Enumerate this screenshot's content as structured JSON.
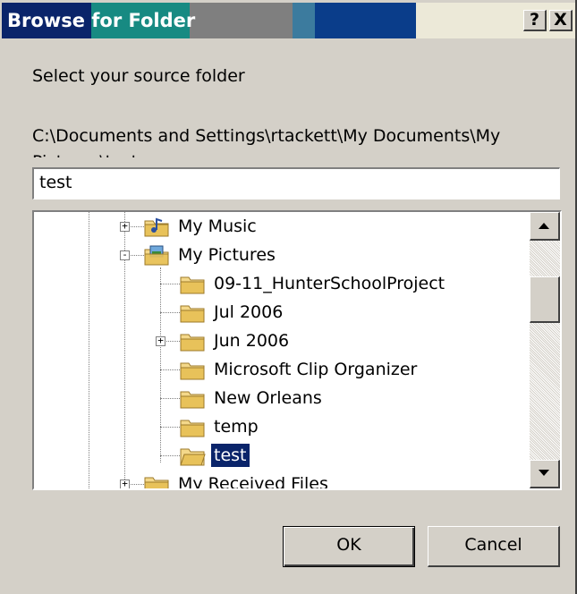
{
  "window": {
    "title_part1": "Browse ",
    "title_part2": "for Folder",
    "help_button": "?",
    "close_button": "X"
  },
  "prompt": "Select your source folder",
  "path_label": "C:\\Documents and Settings\\rtackett\\My Documents\\My Pictures\\test",
  "folder_input": {
    "value": "test"
  },
  "tree": {
    "items": [
      {
        "label": "My Music",
        "icon": "music-folder-icon",
        "expander": "+"
      },
      {
        "label": "My Pictures",
        "icon": "pictures-folder-icon",
        "expander": "-"
      },
      {
        "label": "09-11_HunterSchoolProject",
        "icon": "folder-icon"
      },
      {
        "label": "Jul 2006",
        "icon": "folder-icon"
      },
      {
        "label": "Jun 2006",
        "icon": "folder-icon",
        "expander": "+"
      },
      {
        "label": "Microsoft Clip Organizer",
        "icon": "folder-icon"
      },
      {
        "label": "New Orleans",
        "icon": "folder-icon"
      },
      {
        "label": "temp",
        "icon": "folder-icon"
      },
      {
        "label": "test",
        "icon": "open-folder-icon",
        "selected": true
      },
      {
        "label": "My Received Files",
        "icon": "folder-icon",
        "expander": "+"
      }
    ]
  },
  "buttons": {
    "ok": "OK",
    "cancel": "Cancel"
  },
  "colors": {
    "title_active": "#0a246a",
    "selection": "#0a246a",
    "face": "#d4d0c8"
  }
}
